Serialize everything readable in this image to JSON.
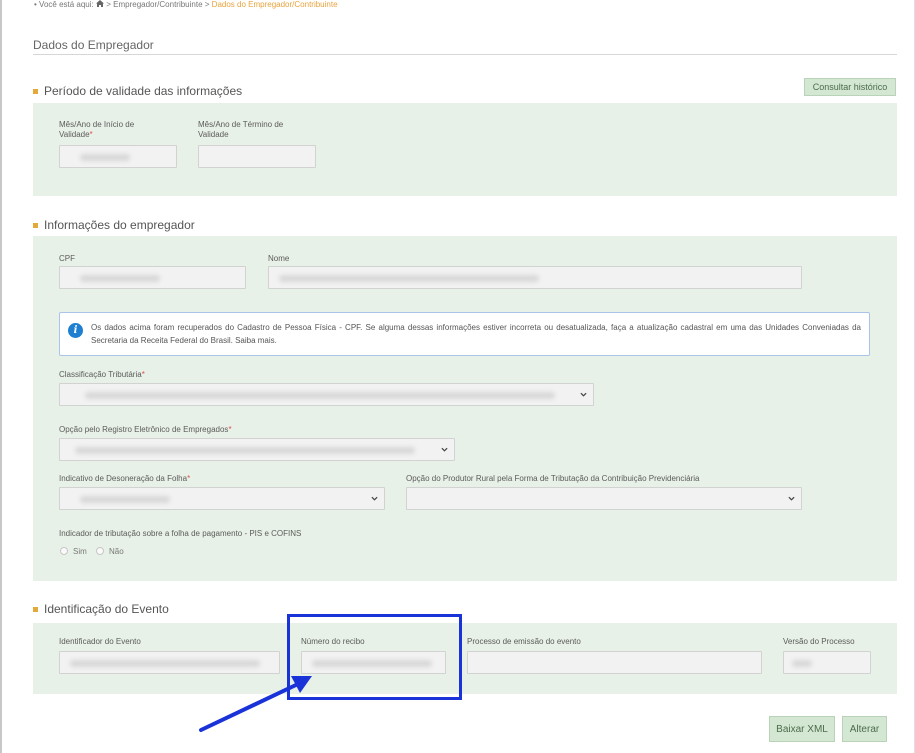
{
  "breadcrumb": {
    "prefix": "Você está aqui:",
    "home_icon": "home-icon",
    "item1": "Empregador/Contribuinte",
    "separator": ">",
    "current": "Dados do Empregador/Contribuinte"
  },
  "page_title": "Dados do Empregador",
  "validity": {
    "title": "Período de validade das informações",
    "history_button": "Consultar histórico",
    "start_label_1": "Mês/Ano de Início de",
    "start_label_2": "Validade",
    "required_mark": "*",
    "end_label_1": "Mês/Ano de Término de",
    "end_label_2": "Validade"
  },
  "employer": {
    "title": "Informações do empregador",
    "cpf_label": "CPF",
    "name_label": "Nome",
    "info_text": "Os dados acima foram recuperados do Cadastro de Pessoa Física - CPF. Se alguma dessas informações estiver incorreta ou desatualizada, faça a atualização cadastral em uma das Unidades Conveniadas da Secretaria da Receita Federal do Brasil. Saiba mais.",
    "tax_class_label": "Classificação Tributária",
    "electronic_registry_label": "Opção pelo Registro Eletrônico de Empregados",
    "payroll_relief_label": "Indicativo de Desoneração da Folha",
    "rural_producer_label": "Opção do Produtor Rural pela Forma de Tributação da Contribuição Previdenciária",
    "pis_cofins_label": "Indicador de tributação sobre a folha de pagamento - PIS e COFINS",
    "yes_label": "Sim",
    "no_label": "Não"
  },
  "event": {
    "title": "Identificação do Evento",
    "event_id_label": "Identificador do Evento",
    "receipt_label": "Número do recibo",
    "emission_process_label": "Processo de emissão do evento",
    "process_version_label": "Versão do Processo"
  },
  "actions": {
    "download_xml": "Baixar XML",
    "edit": "Alterar"
  },
  "colors": {
    "panel_bg": "#e8f1e7",
    "accent_orange": "#e5a83a",
    "annotation_blue": "#1a33d8",
    "info_blue": "#1f7fd0"
  }
}
